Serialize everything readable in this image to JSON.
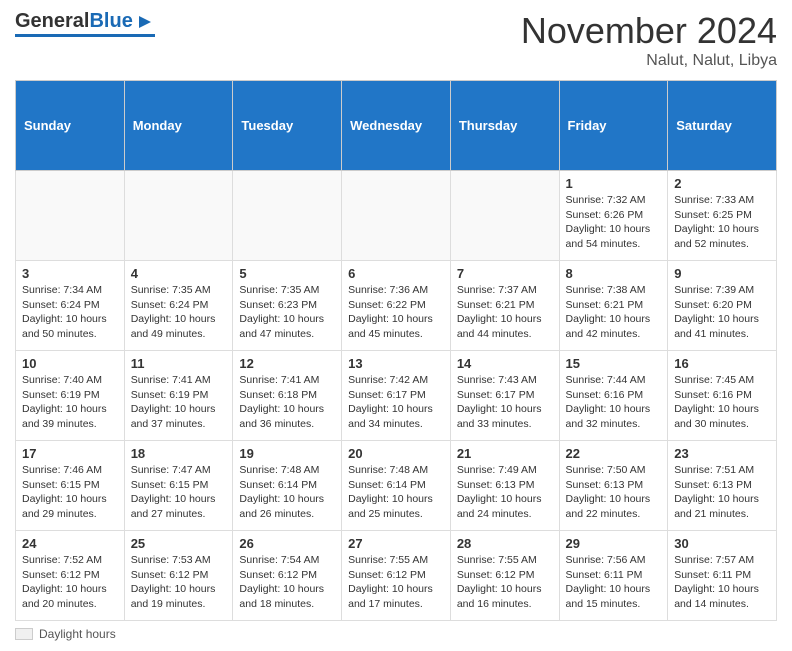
{
  "header": {
    "logo_general": "General",
    "logo_blue": "Blue",
    "month_title": "November 2024",
    "location": "Nalut, Nalut, Libya"
  },
  "footer": {
    "label": "Daylight hours"
  },
  "calendar": {
    "weekdays": [
      "Sunday",
      "Monday",
      "Tuesday",
      "Wednesday",
      "Thursday",
      "Friday",
      "Saturday"
    ],
    "weeks": [
      [
        {
          "day": "",
          "info": ""
        },
        {
          "day": "",
          "info": ""
        },
        {
          "day": "",
          "info": ""
        },
        {
          "day": "",
          "info": ""
        },
        {
          "day": "",
          "info": ""
        },
        {
          "day": "1",
          "info": "Sunrise: 7:32 AM\nSunset: 6:26 PM\nDaylight: 10 hours and 54 minutes."
        },
        {
          "day": "2",
          "info": "Sunrise: 7:33 AM\nSunset: 6:25 PM\nDaylight: 10 hours and 52 minutes."
        }
      ],
      [
        {
          "day": "3",
          "info": "Sunrise: 7:34 AM\nSunset: 6:24 PM\nDaylight: 10 hours and 50 minutes."
        },
        {
          "day": "4",
          "info": "Sunrise: 7:35 AM\nSunset: 6:24 PM\nDaylight: 10 hours and 49 minutes."
        },
        {
          "day": "5",
          "info": "Sunrise: 7:35 AM\nSunset: 6:23 PM\nDaylight: 10 hours and 47 minutes."
        },
        {
          "day": "6",
          "info": "Sunrise: 7:36 AM\nSunset: 6:22 PM\nDaylight: 10 hours and 45 minutes."
        },
        {
          "day": "7",
          "info": "Sunrise: 7:37 AM\nSunset: 6:21 PM\nDaylight: 10 hours and 44 minutes."
        },
        {
          "day": "8",
          "info": "Sunrise: 7:38 AM\nSunset: 6:21 PM\nDaylight: 10 hours and 42 minutes."
        },
        {
          "day": "9",
          "info": "Sunrise: 7:39 AM\nSunset: 6:20 PM\nDaylight: 10 hours and 41 minutes."
        }
      ],
      [
        {
          "day": "10",
          "info": "Sunrise: 7:40 AM\nSunset: 6:19 PM\nDaylight: 10 hours and 39 minutes."
        },
        {
          "day": "11",
          "info": "Sunrise: 7:41 AM\nSunset: 6:19 PM\nDaylight: 10 hours and 37 minutes."
        },
        {
          "day": "12",
          "info": "Sunrise: 7:41 AM\nSunset: 6:18 PM\nDaylight: 10 hours and 36 minutes."
        },
        {
          "day": "13",
          "info": "Sunrise: 7:42 AM\nSunset: 6:17 PM\nDaylight: 10 hours and 34 minutes."
        },
        {
          "day": "14",
          "info": "Sunrise: 7:43 AM\nSunset: 6:17 PM\nDaylight: 10 hours and 33 minutes."
        },
        {
          "day": "15",
          "info": "Sunrise: 7:44 AM\nSunset: 6:16 PM\nDaylight: 10 hours and 32 minutes."
        },
        {
          "day": "16",
          "info": "Sunrise: 7:45 AM\nSunset: 6:16 PM\nDaylight: 10 hours and 30 minutes."
        }
      ],
      [
        {
          "day": "17",
          "info": "Sunrise: 7:46 AM\nSunset: 6:15 PM\nDaylight: 10 hours and 29 minutes."
        },
        {
          "day": "18",
          "info": "Sunrise: 7:47 AM\nSunset: 6:15 PM\nDaylight: 10 hours and 27 minutes."
        },
        {
          "day": "19",
          "info": "Sunrise: 7:48 AM\nSunset: 6:14 PM\nDaylight: 10 hours and 26 minutes."
        },
        {
          "day": "20",
          "info": "Sunrise: 7:48 AM\nSunset: 6:14 PM\nDaylight: 10 hours and 25 minutes."
        },
        {
          "day": "21",
          "info": "Sunrise: 7:49 AM\nSunset: 6:13 PM\nDaylight: 10 hours and 24 minutes."
        },
        {
          "day": "22",
          "info": "Sunrise: 7:50 AM\nSunset: 6:13 PM\nDaylight: 10 hours and 22 minutes."
        },
        {
          "day": "23",
          "info": "Sunrise: 7:51 AM\nSunset: 6:13 PM\nDaylight: 10 hours and 21 minutes."
        }
      ],
      [
        {
          "day": "24",
          "info": "Sunrise: 7:52 AM\nSunset: 6:12 PM\nDaylight: 10 hours and 20 minutes."
        },
        {
          "day": "25",
          "info": "Sunrise: 7:53 AM\nSunset: 6:12 PM\nDaylight: 10 hours and 19 minutes."
        },
        {
          "day": "26",
          "info": "Sunrise: 7:54 AM\nSunset: 6:12 PM\nDaylight: 10 hours and 18 minutes."
        },
        {
          "day": "27",
          "info": "Sunrise: 7:55 AM\nSunset: 6:12 PM\nDaylight: 10 hours and 17 minutes."
        },
        {
          "day": "28",
          "info": "Sunrise: 7:55 AM\nSunset: 6:12 PM\nDaylight: 10 hours and 16 minutes."
        },
        {
          "day": "29",
          "info": "Sunrise: 7:56 AM\nSunset: 6:11 PM\nDaylight: 10 hours and 15 minutes."
        },
        {
          "day": "30",
          "info": "Sunrise: 7:57 AM\nSunset: 6:11 PM\nDaylight: 10 hours and 14 minutes."
        }
      ]
    ]
  }
}
